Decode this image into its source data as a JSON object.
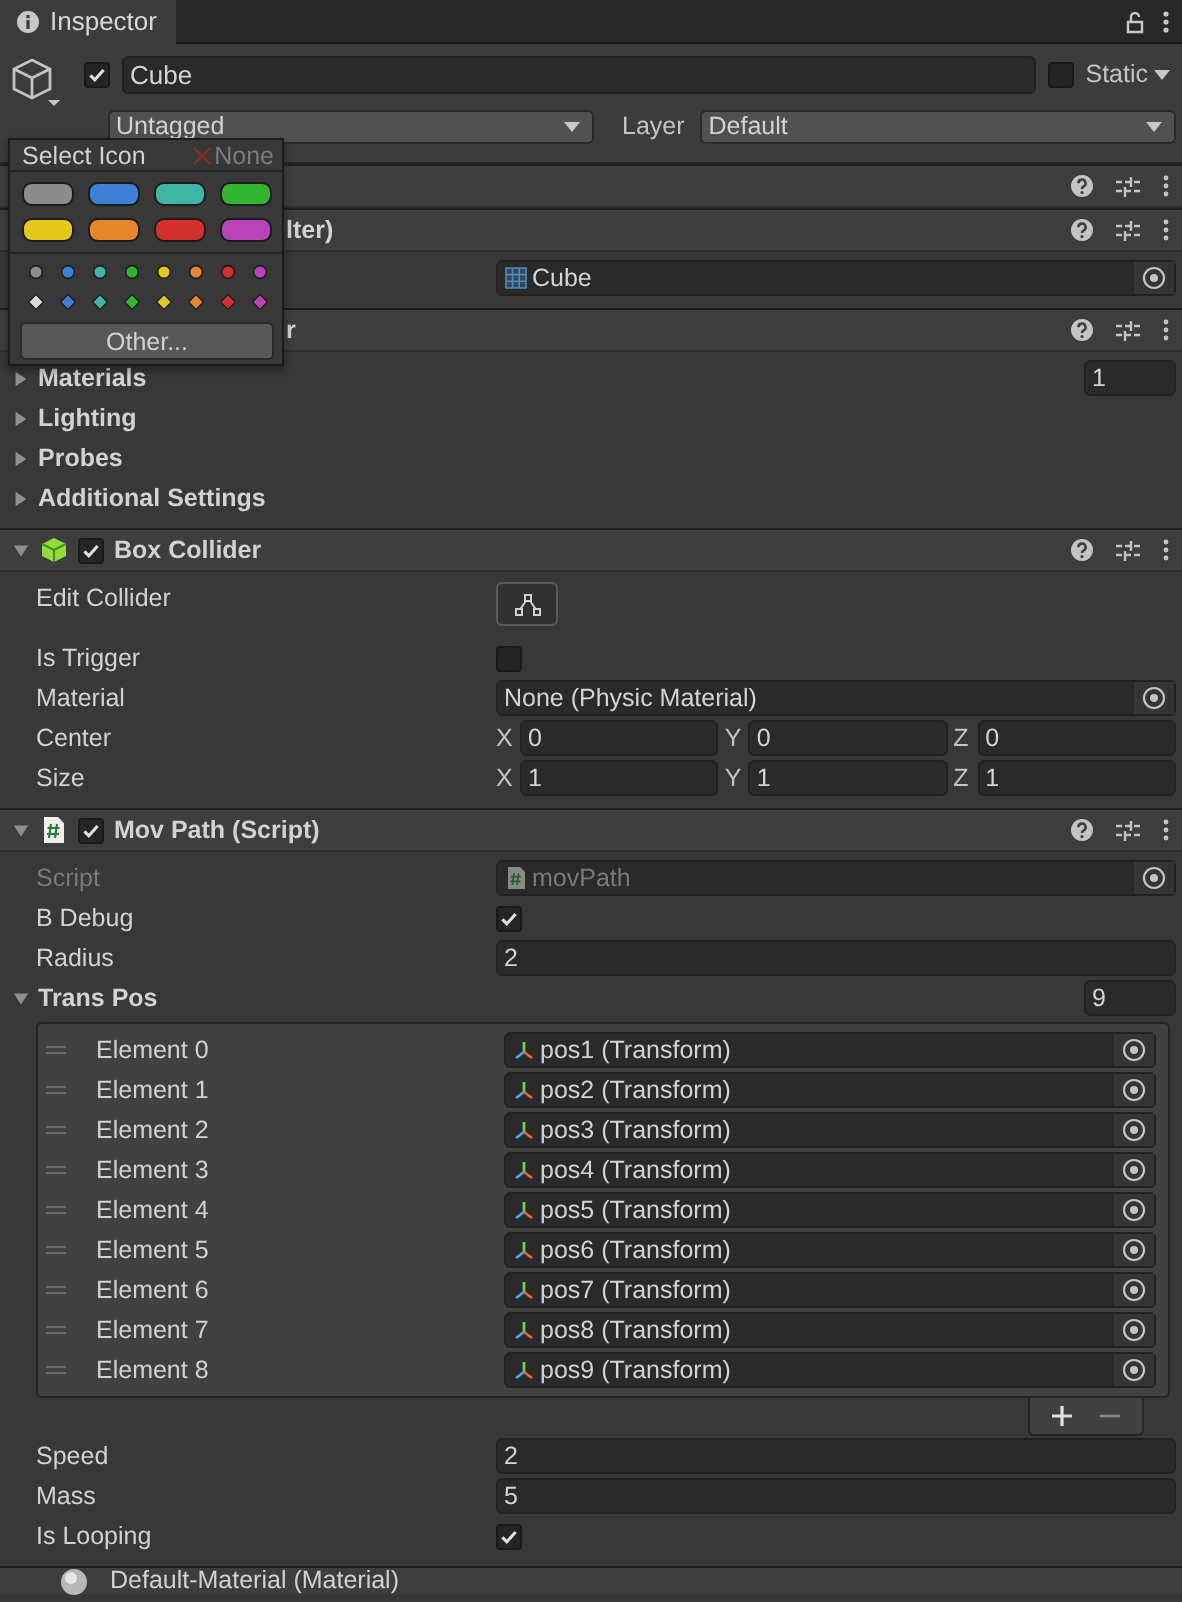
{
  "tab": {
    "label": "Inspector",
    "selected": true
  },
  "object": {
    "active": true,
    "name": "Cube",
    "static": false,
    "static_label": "Static",
    "tag_value": "Untagged",
    "layer_label": "Layer",
    "layer_value": "Default"
  },
  "icon_popup": {
    "title": "Select Icon",
    "none_label": "None",
    "labels": [
      {
        "color": "#8c8c8c"
      },
      {
        "color": "#3f7fd6"
      },
      {
        "color": "#3fb5a6"
      },
      {
        "color": "#2fb52f"
      },
      {
        "color": "#e3c819"
      },
      {
        "color": "#e5872a"
      },
      {
        "color": "#d42f2f"
      },
      {
        "color": "#b844b8"
      }
    ],
    "dots": [
      {
        "color": "#8c8c8c"
      },
      {
        "color": "#3f7fd6"
      },
      {
        "color": "#3fb5a6"
      },
      {
        "color": "#2fb52f"
      },
      {
        "color": "#e3c819"
      },
      {
        "color": "#e5872a"
      },
      {
        "color": "#d42f2f"
      },
      {
        "color": "#b844b8"
      }
    ],
    "diamonds": [
      {
        "color": "#d8d8d8"
      },
      {
        "color": "#3f7fd6"
      },
      {
        "color": "#3fb5a6"
      },
      {
        "color": "#2fb52f"
      },
      {
        "color": "#e3c819"
      },
      {
        "color": "#e5872a"
      },
      {
        "color": "#d42f2f"
      },
      {
        "color": "#b844b8"
      }
    ],
    "other_button": "Other..."
  },
  "components": [
    {
      "kind": "covered"
    },
    {
      "kind": "covered",
      "title": "lter)",
      "rows": [
        {
          "kind": "object",
          "value": "Cube"
        }
      ]
    },
    {
      "kind": "covered",
      "title": "r",
      "rows": [
        {
          "kind": "foldout",
          "label": "Materials",
          "expanded": false,
          "value": "1"
        },
        {
          "kind": "foldout",
          "label": "Lighting",
          "expanded": false
        },
        {
          "kind": "foldout",
          "label": "Probes",
          "expanded": false
        },
        {
          "kind": "foldout",
          "label": "Additional Settings",
          "expanded": false
        }
      ]
    },
    {
      "kind": "full",
      "title": "Box Collider",
      "enabled": true,
      "expanded": true,
      "rows": [
        {
          "kind": "edit_button",
          "label": "Edit Collider"
        },
        {
          "kind": "checkbox",
          "label": "Is Trigger",
          "checked": false
        },
        {
          "kind": "object",
          "label": "Material",
          "value": "None (Physic Material)"
        },
        {
          "kind": "vector3",
          "label": "Center",
          "axes": [
            {
              "axis": "X",
              "value": "0"
            },
            {
              "axis": "Y",
              "value": "0"
            },
            {
              "axis": "Z",
              "value": "0"
            }
          ]
        },
        {
          "kind": "vector3",
          "label": "Size",
          "axes": [
            {
              "axis": "X",
              "value": "1"
            },
            {
              "axis": "Y",
              "value": "1"
            },
            {
              "axis": "Z",
              "value": "1"
            }
          ]
        }
      ]
    },
    {
      "kind": "full",
      "title": "Mov Path (Script)",
      "enabled": true,
      "expanded": true,
      "rows": [
        {
          "kind": "object",
          "label": "Script",
          "value": "movPath",
          "disabled": true
        },
        {
          "kind": "checkbox",
          "label": "B Debug",
          "checked": true
        },
        {
          "kind": "text",
          "label": "Radius",
          "value": "2"
        },
        {
          "kind": "list",
          "label": "Trans Pos",
          "expanded": true,
          "size": "9",
          "elements": [
            {
              "label": "Element 0",
              "value": "pos1 (Transform)"
            },
            {
              "label": "Element 1",
              "value": "pos2 (Transform)"
            },
            {
              "label": "Element 2",
              "value": "pos3 (Transform)"
            },
            {
              "label": "Element 3",
              "value": "pos4 (Transform)"
            },
            {
              "label": "Element 4",
              "value": "pos5 (Transform)"
            },
            {
              "label": "Element 5",
              "value": "pos6 (Transform)"
            },
            {
              "label": "Element 6",
              "value": "pos7 (Transform)"
            },
            {
              "label": "Element 7",
              "value": "pos8 (Transform)"
            },
            {
              "label": "Element 8",
              "value": "pos9 (Transform)"
            }
          ]
        },
        {
          "kind": "text",
          "label": "Speed",
          "value": "2"
        },
        {
          "kind": "text",
          "label": "Mass",
          "value": "5"
        },
        {
          "kind": "checkbox",
          "label": "Is Looping",
          "checked": true
        }
      ]
    },
    {
      "kind": "cut",
      "title": "Default-Material (Material)"
    }
  ]
}
